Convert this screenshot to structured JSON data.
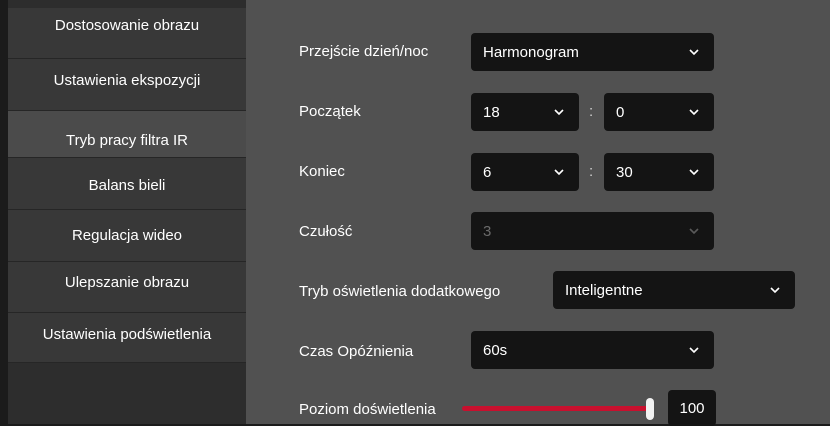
{
  "sidebar": {
    "items": [
      {
        "label": "Dostosowanie obrazu"
      },
      {
        "label": "Ustawienia ekspozycji"
      },
      {
        "label": "Tryb pracy filtra IR",
        "active": true
      },
      {
        "label": "Balans bieli"
      },
      {
        "label": "Regulacja wideo"
      },
      {
        "label": "Ulepszanie obrazu"
      },
      {
        "label": "Ustawienia podświetlenia"
      }
    ]
  },
  "form": {
    "day_night": {
      "label": "Przejście dzień/noc",
      "value": "Harmonogram"
    },
    "start": {
      "label": "Początek",
      "hour": "18",
      "minute": "0",
      "separator": ":"
    },
    "end": {
      "label": "Koniec",
      "hour": "6",
      "minute": "30",
      "separator": ":"
    },
    "sensitivity": {
      "label": "Czułość",
      "value": "3",
      "disabled": true
    },
    "supplement_mode": {
      "label": "Tryb oświetlenia dodatkowego",
      "value": "Inteligentne"
    },
    "delay": {
      "label": "Czas Opóźnienia",
      "value": "60s"
    },
    "level": {
      "label": "Poziom doświetlenia",
      "value": "100",
      "percent": 100
    }
  },
  "colors": {
    "accent": "#c8102e",
    "panel": "#515151",
    "sidebar": "#383838",
    "sidebar_active": "#4b4b4b",
    "field": "#141414"
  },
  "icons": {
    "dropdown": "chevron-down-icon"
  }
}
